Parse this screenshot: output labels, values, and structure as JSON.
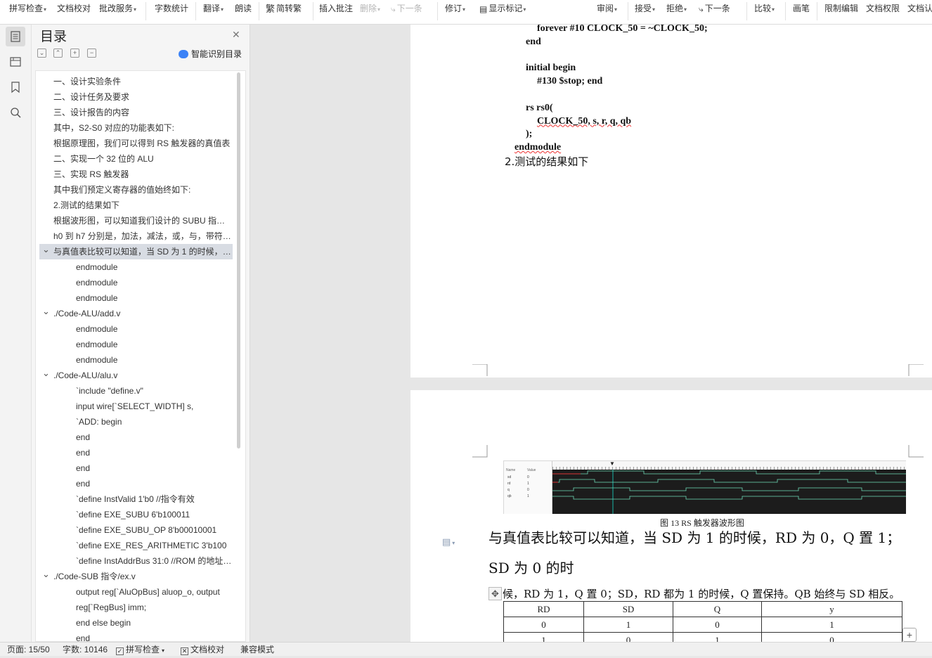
{
  "toolbar": {
    "spell_check": "拼写检查",
    "doc_proofread": "文档校对",
    "annotate_service": "批改服务",
    "word_count": "字数统计",
    "translate": "翻译",
    "read_aloud": "朗读",
    "simp_trad": "简转繁",
    "insert_comment": "插入批注",
    "delete": "删除",
    "next_item": "下一条",
    "revise": "修订",
    "show_marks": "显示标记",
    "review": "审阅",
    "accept": "接受",
    "reject": "拒绝",
    "next_item2": "下一条",
    "compare": "比较",
    "pen": "画笔",
    "restrict_edit": "限制编辑",
    "doc_permission": "文档权限",
    "doc_cert": "文档认"
  },
  "toc": {
    "title": "目录",
    "smart": "智能识别目录",
    "items": [
      {
        "label": "一、设计实验条件",
        "indent": 0,
        "toggle": ""
      },
      {
        "label": "二、设计任务及要求",
        "indent": 0,
        "toggle": ""
      },
      {
        "label": "三、设计报告的内容",
        "indent": 0,
        "toggle": ""
      },
      {
        "label": "其中，S2-S0 对应的功能表如下:",
        "indent": 0,
        "toggle": ""
      },
      {
        "label": "根据原理图，我们可以得到 RS 触发器的真值表",
        "indent": 0,
        "toggle": ""
      },
      {
        "label": "二、实现一个 32 位的 ALU",
        "indent": 0,
        "toggle": ""
      },
      {
        "label": "三、实现 RS 触发器",
        "indent": 0,
        "toggle": ""
      },
      {
        "label": "其中我们预定义寄存器的值始终如下:",
        "indent": 0,
        "toggle": ""
      },
      {
        "label": "2.测试的结果如下",
        "indent": 0,
        "toggle": ""
      },
      {
        "label": "根据波形图，可以知道我们设计的 SUBU 指令的功能",
        "indent": 0,
        "toggle": ""
      },
      {
        "label": "h0 到 h7 分别是，加法，减法，或，与，带符号比较",
        "indent": 0,
        "toggle": ""
      },
      {
        "label": "与真值表比较可以知道，当 SD 为 1 的时候，RD 为 0",
        "indent": 0,
        "toggle": "v",
        "selected": true
      },
      {
        "label": "endmodule",
        "indent": 1,
        "toggle": ""
      },
      {
        "label": "endmodule",
        "indent": 1,
        "toggle": ""
      },
      {
        "label": "endmodule",
        "indent": 1,
        "toggle": ""
      },
      {
        "label": "./Code-ALU/add.v",
        "indent": 0,
        "toggle": "v"
      },
      {
        "label": "endmodule",
        "indent": 1,
        "toggle": ""
      },
      {
        "label": "endmodule",
        "indent": 1,
        "toggle": ""
      },
      {
        "label": "endmodule",
        "indent": 1,
        "toggle": ""
      },
      {
        "label": "./Code-ALU/alu.v",
        "indent": 0,
        "toggle": "v"
      },
      {
        "label": "`include \"define.v\"",
        "indent": 1,
        "toggle": ""
      },
      {
        "label": "input wire[`SELECT_WIDTH] s,",
        "indent": 1,
        "toggle": ""
      },
      {
        "label": "`ADD: begin",
        "indent": 1,
        "toggle": ""
      },
      {
        "label": "end",
        "indent": 1,
        "toggle": ""
      },
      {
        "label": "end",
        "indent": 1,
        "toggle": ""
      },
      {
        "label": "end",
        "indent": 1,
        "toggle": ""
      },
      {
        "label": "end",
        "indent": 1,
        "toggle": ""
      },
      {
        "label": "`define InstValid 1'b0  //指令有效",
        "indent": 1,
        "toggle": ""
      },
      {
        "label": "`define EXE_SUBU 6'b100011",
        "indent": 1,
        "toggle": ""
      },
      {
        "label": "`define EXE_SUBU_OP 8'b00010001",
        "indent": 1,
        "toggle": ""
      },
      {
        "label": "`define EXE_RES_ARITHMETIC 3'b100",
        "indent": 1,
        "toggle": ""
      },
      {
        "label": "`define InstAddrBus 31:0 //ROM 的地址总线",
        "indent": 1,
        "toggle": ""
      },
      {
        "label": "./Code-SUB 指令/ex.v",
        "indent": 0,
        "toggle": "v"
      },
      {
        "label": "output reg[`AluOpBus] aluop_o, output",
        "indent": 1,
        "toggle": ""
      },
      {
        "label": "reg[`RegBus] imm;",
        "indent": 1,
        "toggle": ""
      },
      {
        "label": "end else begin",
        "indent": 1,
        "toggle": ""
      },
      {
        "label": "end",
        "indent": 1,
        "toggle": ""
      }
    ]
  },
  "page1": {
    "code": [
      {
        "text": "forever #10 CLOCK_50 = ~CLOCK_50;",
        "lvl": 2
      },
      {
        "text": "end",
        "lvl": 1
      },
      {
        "text": "",
        "lvl": 0
      },
      {
        "text": "initial begin",
        "lvl": 1
      },
      {
        "text": "#130 $stop; end",
        "lvl": 2
      },
      {
        "text": "",
        "lvl": 0
      },
      {
        "text": "rs rs0(",
        "lvl": 1
      },
      {
        "text": "CLOCK_50, s, r, q, qb",
        "lvl": 2
      },
      {
        "text": ");",
        "lvl": 1
      },
      {
        "text": "endmodule",
        "lvl": 0
      }
    ],
    "result": "2.测试的结果如下"
  },
  "page2": {
    "figure_caption": "图 13 RS 触发器波形图",
    "wave_signals": [
      "sd",
      "rd",
      "q",
      "qb"
    ],
    "wave_values": [
      "0",
      "1",
      "0",
      "1"
    ],
    "wave_name_header": "Name",
    "wave_value_header": "Value",
    "heading_line1": "与真值表比较可以知道，当 SD 为 1 的时候，RD 为 0，Q 置 1；",
    "heading_line2": "SD 为 0 的时",
    "para": "候，RD 为 1，Q 置 0；SD，RD 都为 1 的时候，Q 置保持。QB 始终与 SD 相反。",
    "table_headers": [
      "RD",
      "SD",
      "Q",
      "y"
    ],
    "table_rows": [
      [
        "0",
        "1",
        "0",
        "1"
      ],
      [
        "1",
        "0",
        "1",
        "0"
      ]
    ]
  },
  "status": {
    "page": "页面: 15/50",
    "words": "字数: 10146",
    "spell": "拼写检查",
    "proof": "文档校对",
    "compat": "兼容模式"
  }
}
